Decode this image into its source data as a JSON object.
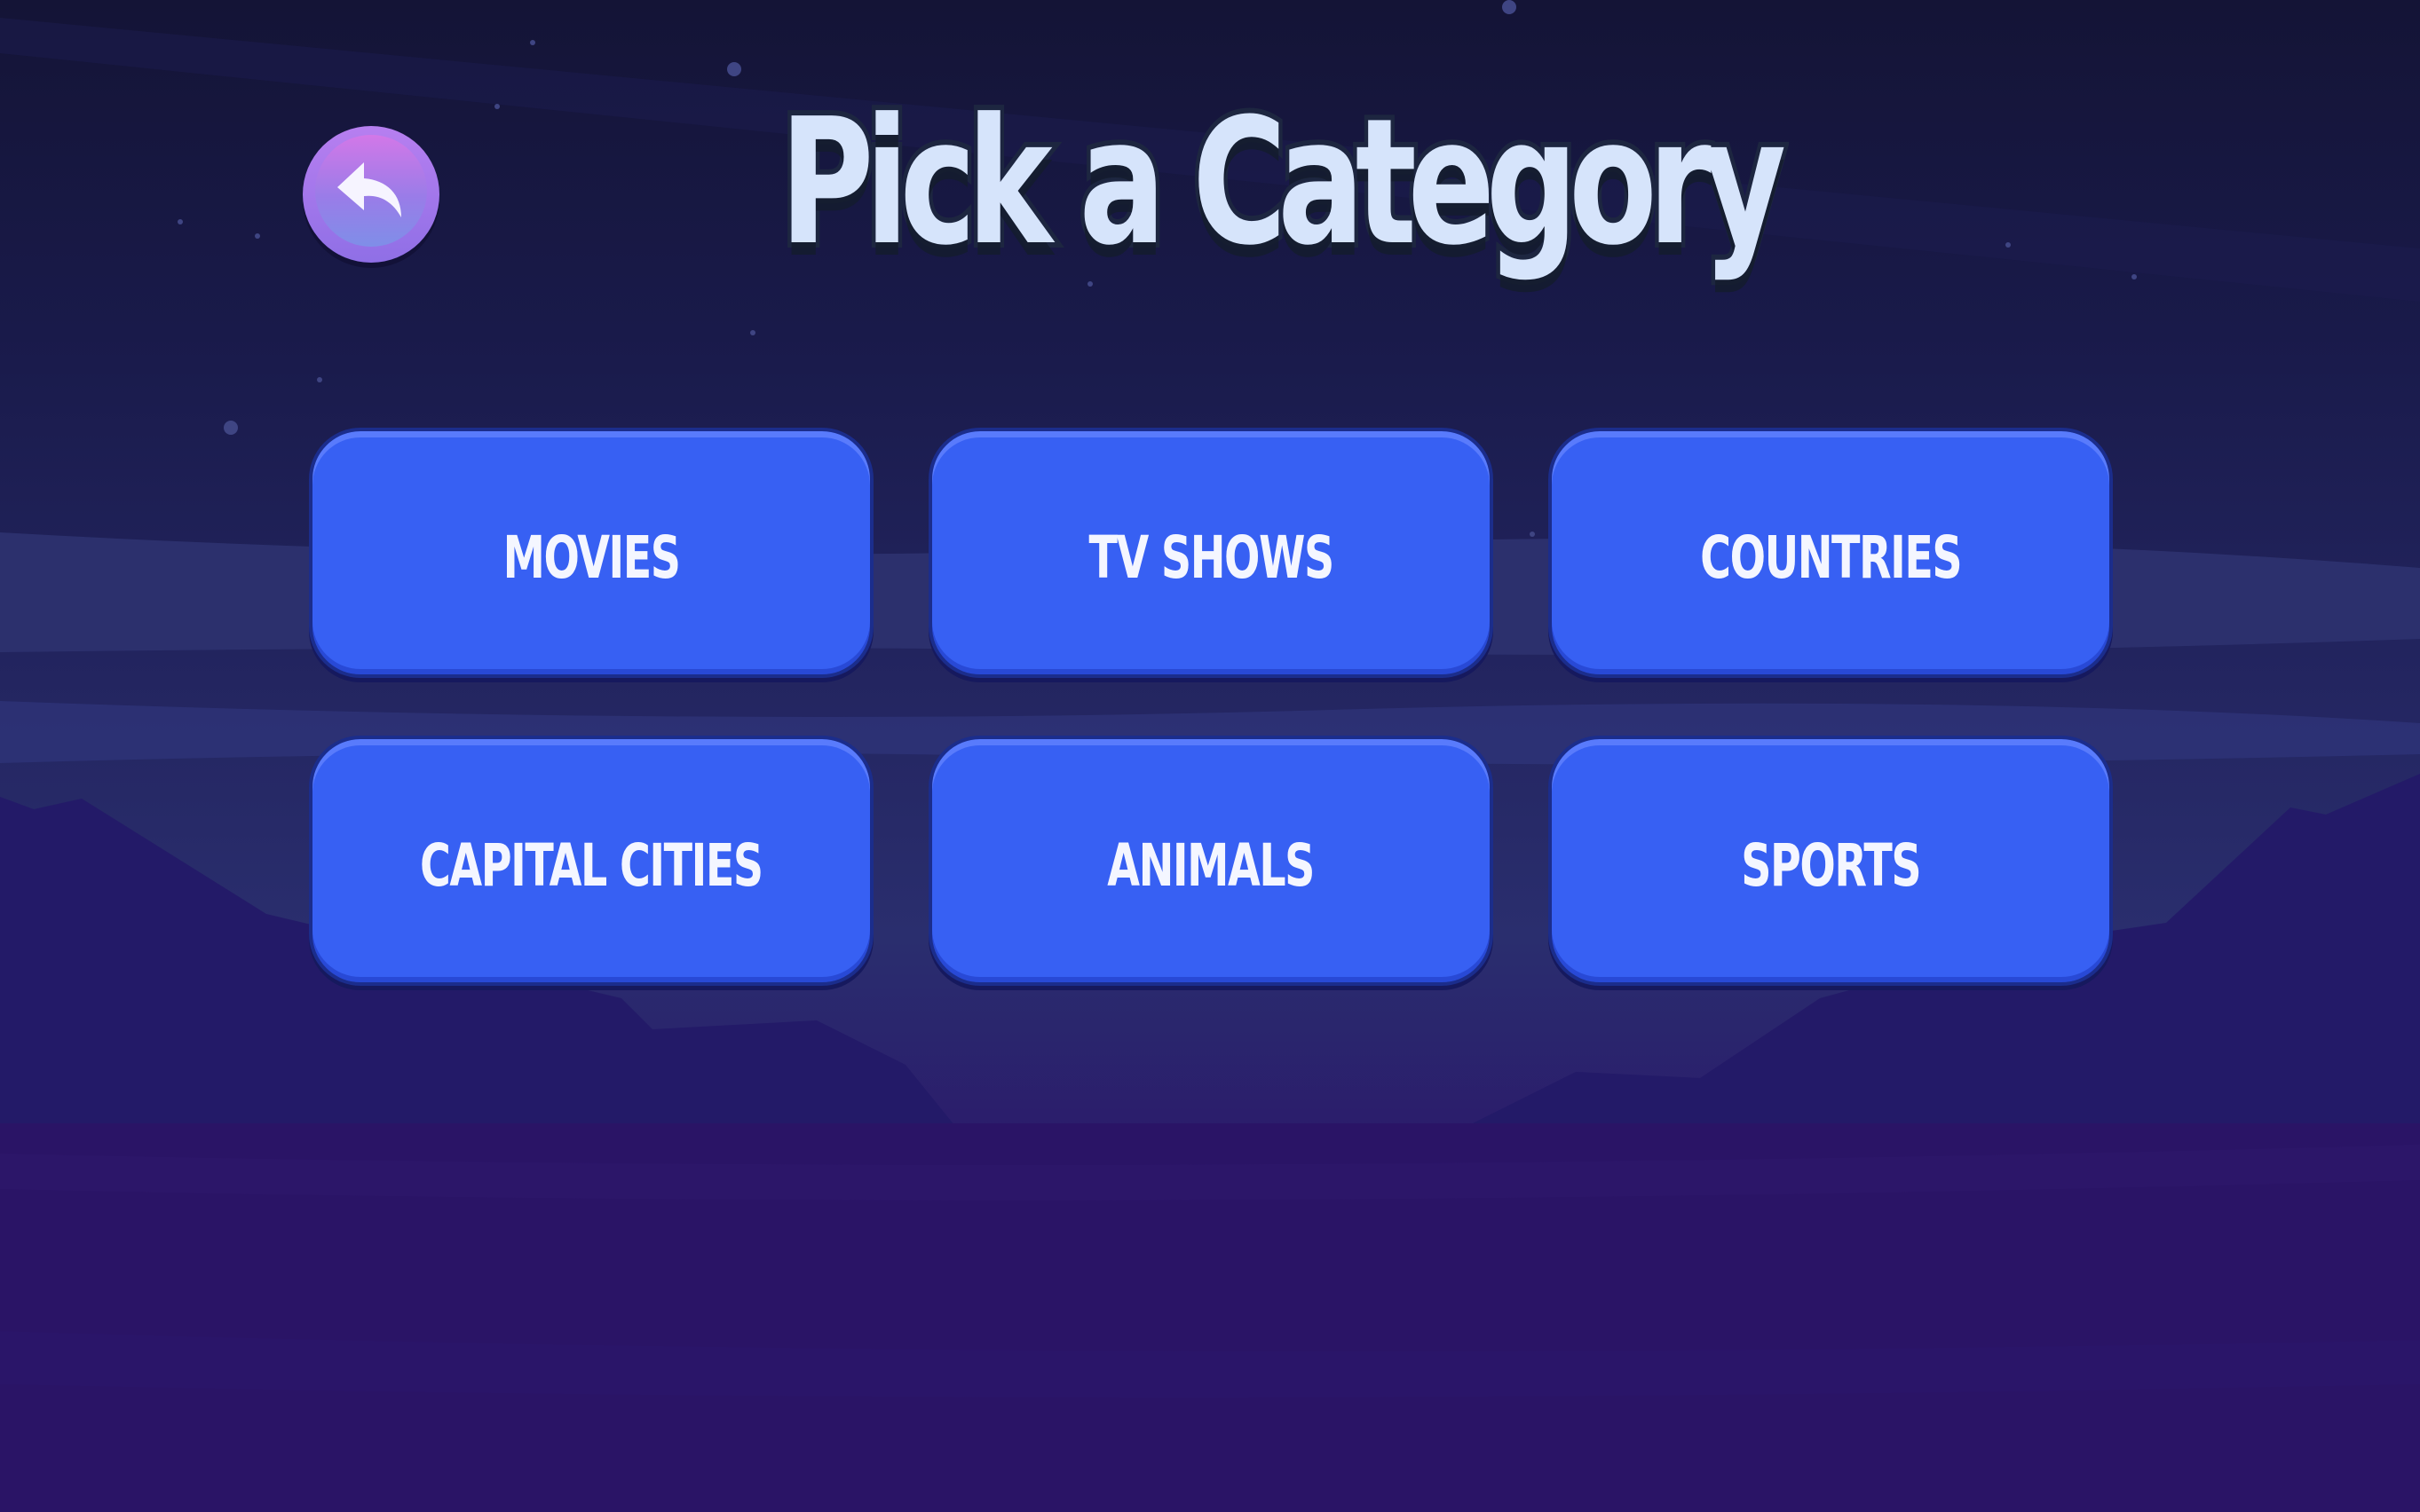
{
  "screen": {
    "title": "Pick a Category",
    "back_icon": "back-arrow-icon"
  },
  "categories": [
    {
      "label": "MOVIES"
    },
    {
      "label": "TV SHOWS"
    },
    {
      "label": "COUNTRIES"
    },
    {
      "label": "CAPITAL CITIES"
    },
    {
      "label": "ANIMALS"
    },
    {
      "label": "SPORTS"
    }
  ],
  "colors": {
    "button_fill": "#3760f3",
    "title_fill": "#d6e4fb",
    "back_button": "#b77ff0",
    "sky_top": "#141436",
    "ground": "#2a1466"
  }
}
